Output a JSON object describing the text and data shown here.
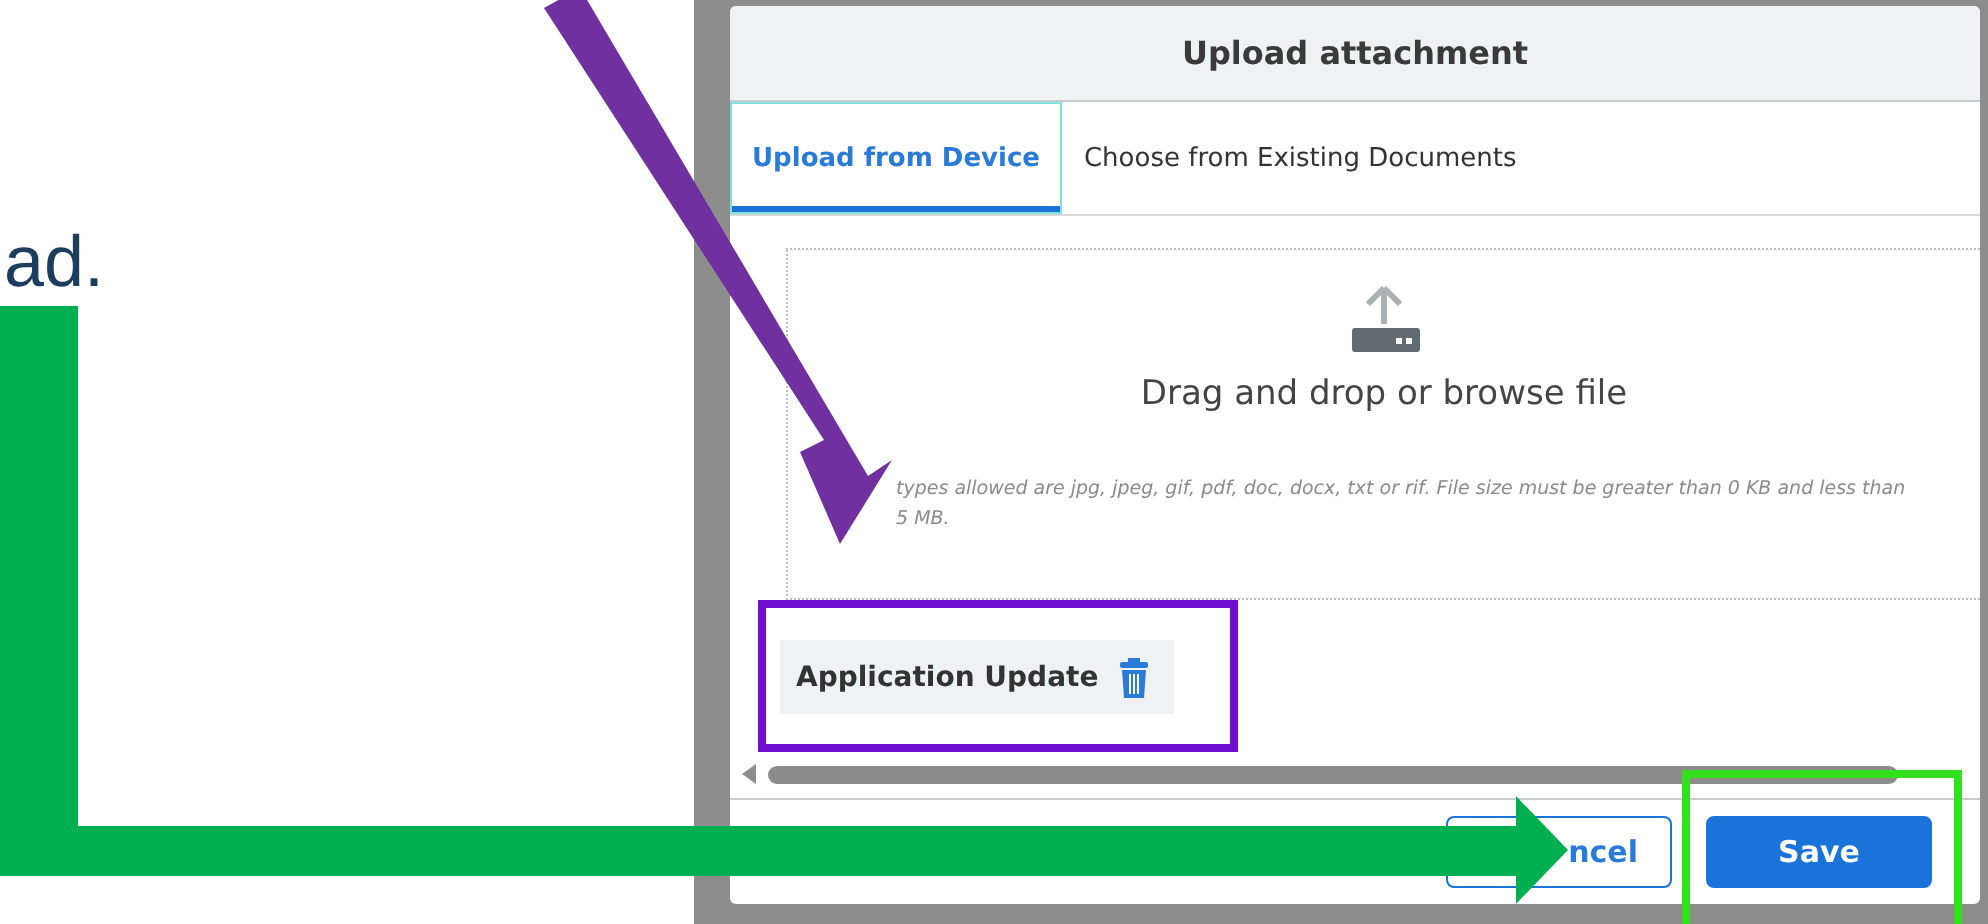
{
  "page_text": "ad.",
  "dialog": {
    "title": "Upload attachment",
    "tabs": [
      {
        "label": "Upload from Device",
        "selected": true
      },
      {
        "label": "Choose from Existing Documents",
        "selected": false
      }
    ],
    "dropzone": {
      "prompt": "Drag and drop or browse file",
      "hint": "types allowed are jpg, jpeg, gif, pdf, doc, docx, txt or rif. File size must be greater than 0 KB and less than 5 MB."
    },
    "attachments": [
      {
        "name": "Application Update"
      }
    ],
    "buttons": [
      {
        "kind": "secondary",
        "label": "ncel"
      },
      {
        "kind": "primary",
        "label": "Save"
      }
    ]
  }
}
